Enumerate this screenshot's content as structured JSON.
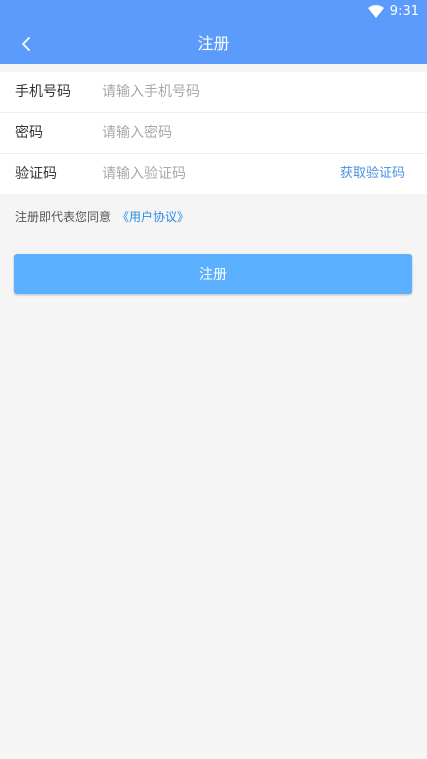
{
  "status_bar": {
    "time": "9:31",
    "wifi_icon": "wifi-icon"
  },
  "app_bar": {
    "title": "注册",
    "back_icon": "chevron-left-icon"
  },
  "form": {
    "phone": {
      "label": "手机号码",
      "placeholder": "请输入手机号码",
      "value": ""
    },
    "password": {
      "label": "密码",
      "placeholder": "请输入密码",
      "value": ""
    },
    "code": {
      "label": "验证码",
      "placeholder": "请输入验证码",
      "value": "",
      "get_code_label": "获取验证码"
    }
  },
  "agreement": {
    "text": "注册即代表您同意",
    "link": "《用户协议》"
  },
  "register_button": {
    "label": "注册"
  },
  "colors": {
    "primary": "#5b9bfb",
    "button": "#5aaffe",
    "link": "#2b8be6",
    "background": "#f5f5f5"
  }
}
